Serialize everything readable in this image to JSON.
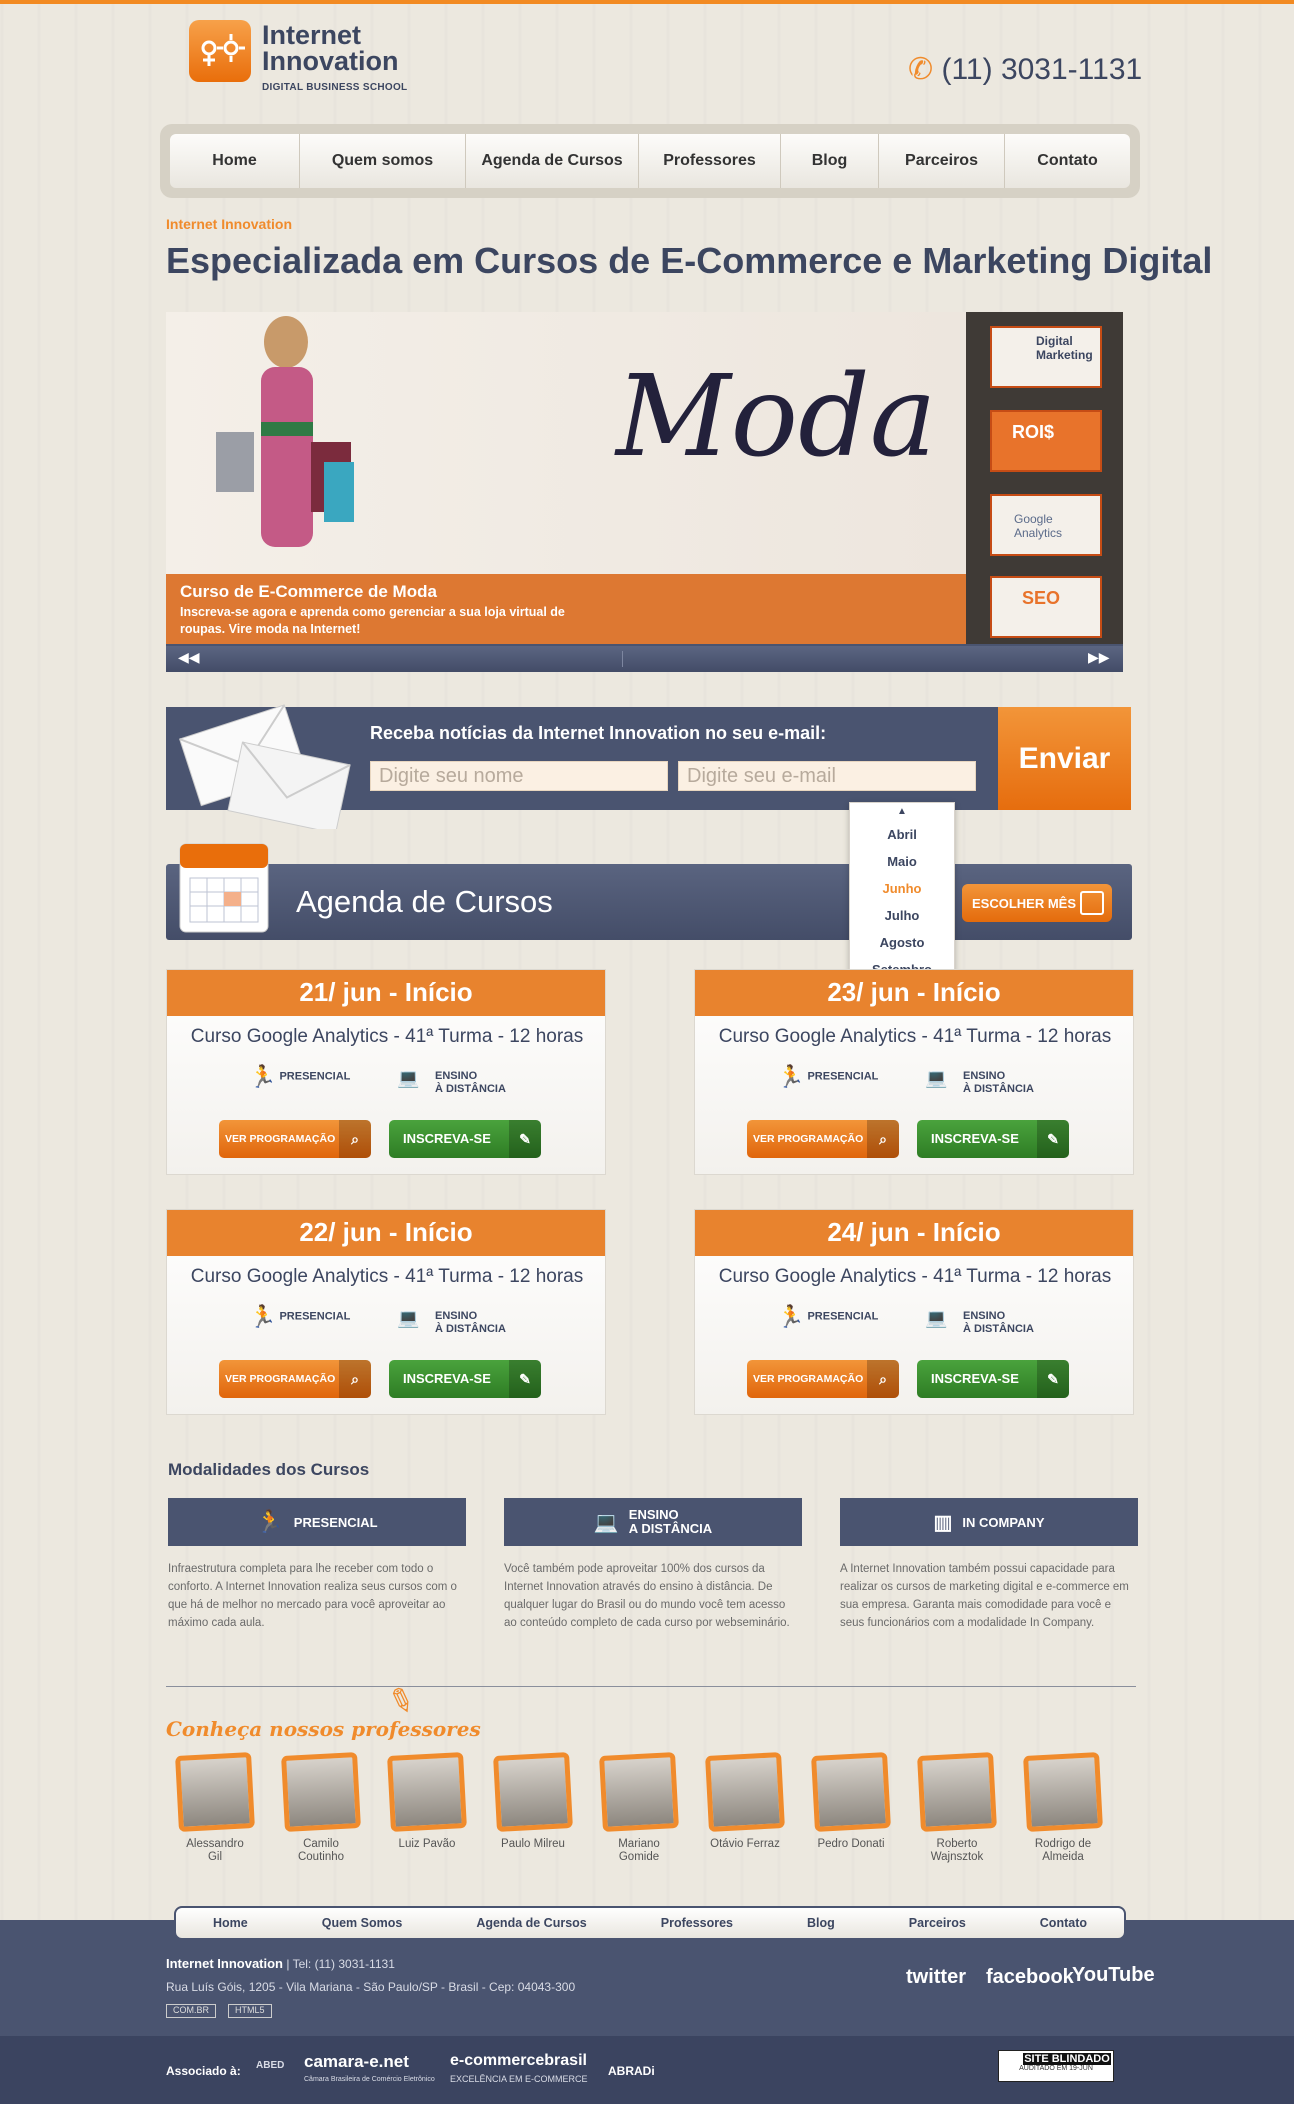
{
  "header": {
    "logo_line1": "Internet",
    "logo_line2": "Innovation",
    "logo_tagline": "DIGITAL BUSINESS SCHOOL",
    "phone": "(11) 3031-1131"
  },
  "nav": {
    "items": [
      "Home",
      "Quem somos",
      "Agenda de Cursos",
      "Professores",
      "Blog",
      "Parceiros",
      "Contato"
    ]
  },
  "hero": {
    "kicker": "Internet Innovation",
    "headline": "Especializada em Cursos de E-Commerce e Marketing Digital"
  },
  "slider": {
    "slide_word": "Moda",
    "caption_title": "Curso de E-Commerce de Moda",
    "caption_text": "Inscreva-se agora e aprenda como gerenciar a sua loja virtual de roupas. Vire moda na Internet!",
    "thumbs": [
      "Digital Marketing",
      "ROI$",
      "Google Analytics",
      "SEO"
    ],
    "prev_icon": "rewind-icon",
    "next_icon": "fast-forward-icon"
  },
  "newsletter": {
    "label": "Receba notícias da Internet Innovation no seu e-mail:",
    "name_placeholder": "Digite seu nome",
    "email_placeholder": "Digite seu e-mail",
    "button": "Enviar"
  },
  "agenda": {
    "title": "Agenda de Cursos",
    "choose_month": "ESCOLHER MÊS",
    "months": [
      "Abril",
      "Maio",
      "Junho",
      "Julho",
      "Agosto",
      "Setembro"
    ],
    "selected_month": "Junho",
    "cards": [
      {
        "date": "21/ jun - Início",
        "title": "Curso Google Analytics - 41ª Turma - 12 horas"
      },
      {
        "date": "23/ jun - Início",
        "title": "Curso Google Analytics - 41ª Turma - 12 horas"
      },
      {
        "date": "22/ jun - Início",
        "title": "Curso Google Analytics - 41ª Turma - 12 horas"
      },
      {
        "date": "24/ jun - Início",
        "title": "Curso Google Analytics - 41ª Turma - 12 horas"
      }
    ],
    "mode_presencial": "PRESENCIAL",
    "mode_ead_1": "ENSINO",
    "mode_ead_2": "À DISTÂNCIA",
    "btn_ver": "VER PROGRAMAÇÃO",
    "btn_inscreva": "INSCREVA-SE"
  },
  "modalidades": {
    "title": "Modalidades dos Cursos",
    "items": [
      {
        "label": "PRESENCIAL",
        "label2": "",
        "text": "Infraestrutura completa para lhe receber com todo o conforto. A Internet Innovation realiza seus cursos com o que há de melhor no mercado para você aproveitar ao máximo cada aula."
      },
      {
        "label": "ENSINO",
        "label2": "A DISTÂNCIA",
        "text": "Você também pode aproveitar 100% dos cursos da Internet Innovation através do ensino à distância. De qualquer lugar do Brasil ou do mundo você tem acesso ao conteúdo completo de cada curso por webseminário."
      },
      {
        "label": "IN COMPANY",
        "label2": "",
        "text": "A Internet Innovation também possui capacidade para realizar os cursos de marketing digital e e-commerce em sua empresa. Garanta mais comodidade para você e seus funcionários com a modalidade In Company."
      }
    ]
  },
  "professores": {
    "title": "Conheça nossos professores",
    "list": [
      {
        "l1": "Alessandro",
        "l2": "Gil"
      },
      {
        "l1": "Camilo",
        "l2": "Coutinho"
      },
      {
        "l1": "Luiz Pavão",
        "l2": ""
      },
      {
        "l1": "Paulo Milreu",
        "l2": ""
      },
      {
        "l1": "Mariano",
        "l2": "Gomide"
      },
      {
        "l1": "Otávio Ferraz",
        "l2": ""
      },
      {
        "l1": "Pedro Donati",
        "l2": ""
      },
      {
        "l1": "Roberto",
        "l2": "Wajnsztok"
      },
      {
        "l1": "Rodrigo de",
        "l2": "Almeida"
      }
    ]
  },
  "footer": {
    "nav": [
      "Home",
      "Quem Somos",
      "Agenda de Cursos",
      "Professores",
      "Blog",
      "Parceiros",
      "Contato"
    ],
    "company": "Internet Innovation",
    "tel": "| Tel: (11) 3031-1131",
    "address": "Rua Luís Góis, 1205 - Vila Mariana - São Paulo/SP - Brasil - Cep: 04043-300",
    "badge1": "COM.BR",
    "badge2": "HTML5",
    "social": [
      "twitter",
      "facebook",
      "YouTube"
    ],
    "associado": "Associado à:",
    "assoc1": "ABED",
    "assoc2": "camara-e.net",
    "assoc2_sub": "Câmara Brasileira de Comércio Eletrônico",
    "assoc3": "e-commercebrasil",
    "assoc3_sub": "EXCELÊNCIA EM E-COMMERCE",
    "assoc4": "ABRADi",
    "seal": "SITE BLINDADO",
    "seal_sub": "AUDITADO EM 19-JUN"
  }
}
